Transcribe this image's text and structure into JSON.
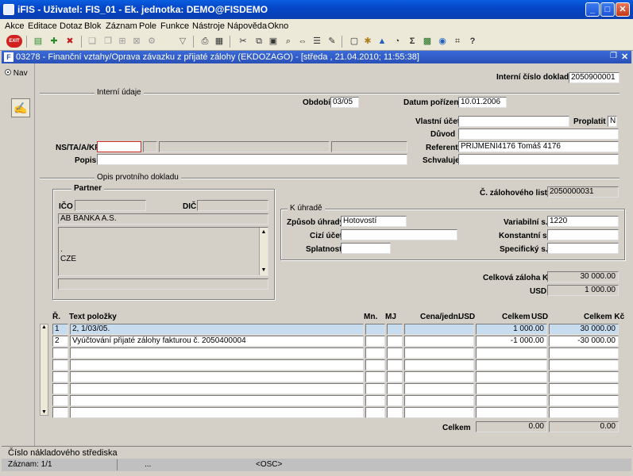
{
  "window": {
    "title": "iFIS - Uživatel: FIS_01 - Ek. jednotka: DEMO@FISDEMO"
  },
  "menu": [
    "Akce",
    "Editace",
    "Dotaz",
    "Blok",
    "Záznam",
    "Pole",
    "Funkce",
    "Nástroje",
    "Nápověda",
    "Okno"
  ],
  "toolbar": {
    "exit_label": "EXIT",
    "sum_glyph": "Σ",
    "help_glyph": "?"
  },
  "form_window": {
    "title": "03278 - Finanční vztahy/Oprava závazku z přijaté zálohy (EKDOZAGO) - [středa , 21.04.2010; 11:55:38]"
  },
  "nav": {
    "label": "Nav"
  },
  "header": {
    "internal_doc_label": "Interní číslo dokladu",
    "internal_doc_value": "2050900001"
  },
  "internal": {
    "section_label": "Interní údaje",
    "period_label": "Období",
    "period_value": "03/05",
    "acq_date_label": "Datum pořízení",
    "acq_date_value": "10.01.2006",
    "own_account_label": "Vlastní účet",
    "own_account_value": "",
    "pay_label": "Proplatit",
    "pay_value": "N",
    "reason_label": "Důvod",
    "reason_value": "",
    "nsta_label": "NS/TA/A/KP",
    "referent_label": "Referent",
    "referent_value": "PRIJMENI4176 Tomáš 4176",
    "desc_label": "Popis",
    "desc_value": "",
    "approves_label": "Schvaluje",
    "approves_value": ""
  },
  "primary": {
    "section_label": "Opis prvotního dokladu",
    "partner_label": "Partner",
    "ico_label": "IČO",
    "ico_value": "",
    "dic_label": "DIČ",
    "dic_value": "",
    "partner_name": "AB BANKA A.S.",
    "address_line1": ".",
    "address_line2": "CZE",
    "advance_no_label": "Č. zálohového listu",
    "advance_no_value": "2050000031"
  },
  "payment": {
    "section_label": "K úhradě",
    "method_label": "Způsob úhrady",
    "method_value": "Hotovostí",
    "foreign_account_label": "Cizí účet",
    "foreign_account_value": "",
    "due_label": "Splatnost",
    "due_value": "",
    "var_symbol_label": "Variabilní s.",
    "var_symbol_value": "1220",
    "const_symbol_label": "Konstantní s.",
    "const_symbol_value": "",
    "spec_symbol_label": "Specifický s.",
    "spec_symbol_value": ""
  },
  "totals": {
    "advance_total_label": "Celková záloha Kč",
    "advance_total_value": "30 000.00",
    "usd_label": "USD",
    "usd_value": "1 000.00"
  },
  "items": {
    "columns": {
      "r": "Ř.",
      "text": "Text položky",
      "mn": "Mn.",
      "mj": "MJ",
      "unit_price": "Cena/jedn.",
      "unit_price_cur": "USD",
      "total": "Celkem",
      "total_cur": "USD",
      "total_czk": "Celkem Kč"
    },
    "rows": [
      {
        "r": "1",
        "text": "2, 1/03/05.",
        "mn": "",
        "mj": "",
        "unit_price": "",
        "total": "1 000.00",
        "total_czk": "30 000.00"
      },
      {
        "r": "2",
        "text": "Vyúčtování přijaté zálohy fakturou č. 2050400004",
        "mn": "",
        "mj": "",
        "unit_price": "",
        "total": "-1 000.00",
        "total_czk": "-30 000.00"
      },
      {
        "r": "",
        "text": "",
        "mn": "",
        "mj": "",
        "unit_price": "",
        "total": "",
        "total_czk": ""
      },
      {
        "r": "",
        "text": "",
        "mn": "",
        "mj": "",
        "unit_price": "",
        "total": "",
        "total_czk": ""
      },
      {
        "r": "",
        "text": "",
        "mn": "",
        "mj": "",
        "unit_price": "",
        "total": "",
        "total_czk": ""
      },
      {
        "r": "",
        "text": "",
        "mn": "",
        "mj": "",
        "unit_price": "",
        "total": "",
        "total_czk": ""
      },
      {
        "r": "",
        "text": "",
        "mn": "",
        "mj": "",
        "unit_price": "",
        "total": "",
        "total_czk": ""
      },
      {
        "r": "",
        "text": "",
        "mn": "",
        "mj": "",
        "unit_price": "",
        "total": "",
        "total_czk": ""
      }
    ],
    "sum_label": "Celkem",
    "sum_total": "0.00",
    "sum_total_czk": "0.00"
  },
  "status": {
    "hint": "Číslo nákladového střediska",
    "record": "Záznam: 1/1",
    "dots": "...",
    "mode": "<OSC>"
  }
}
